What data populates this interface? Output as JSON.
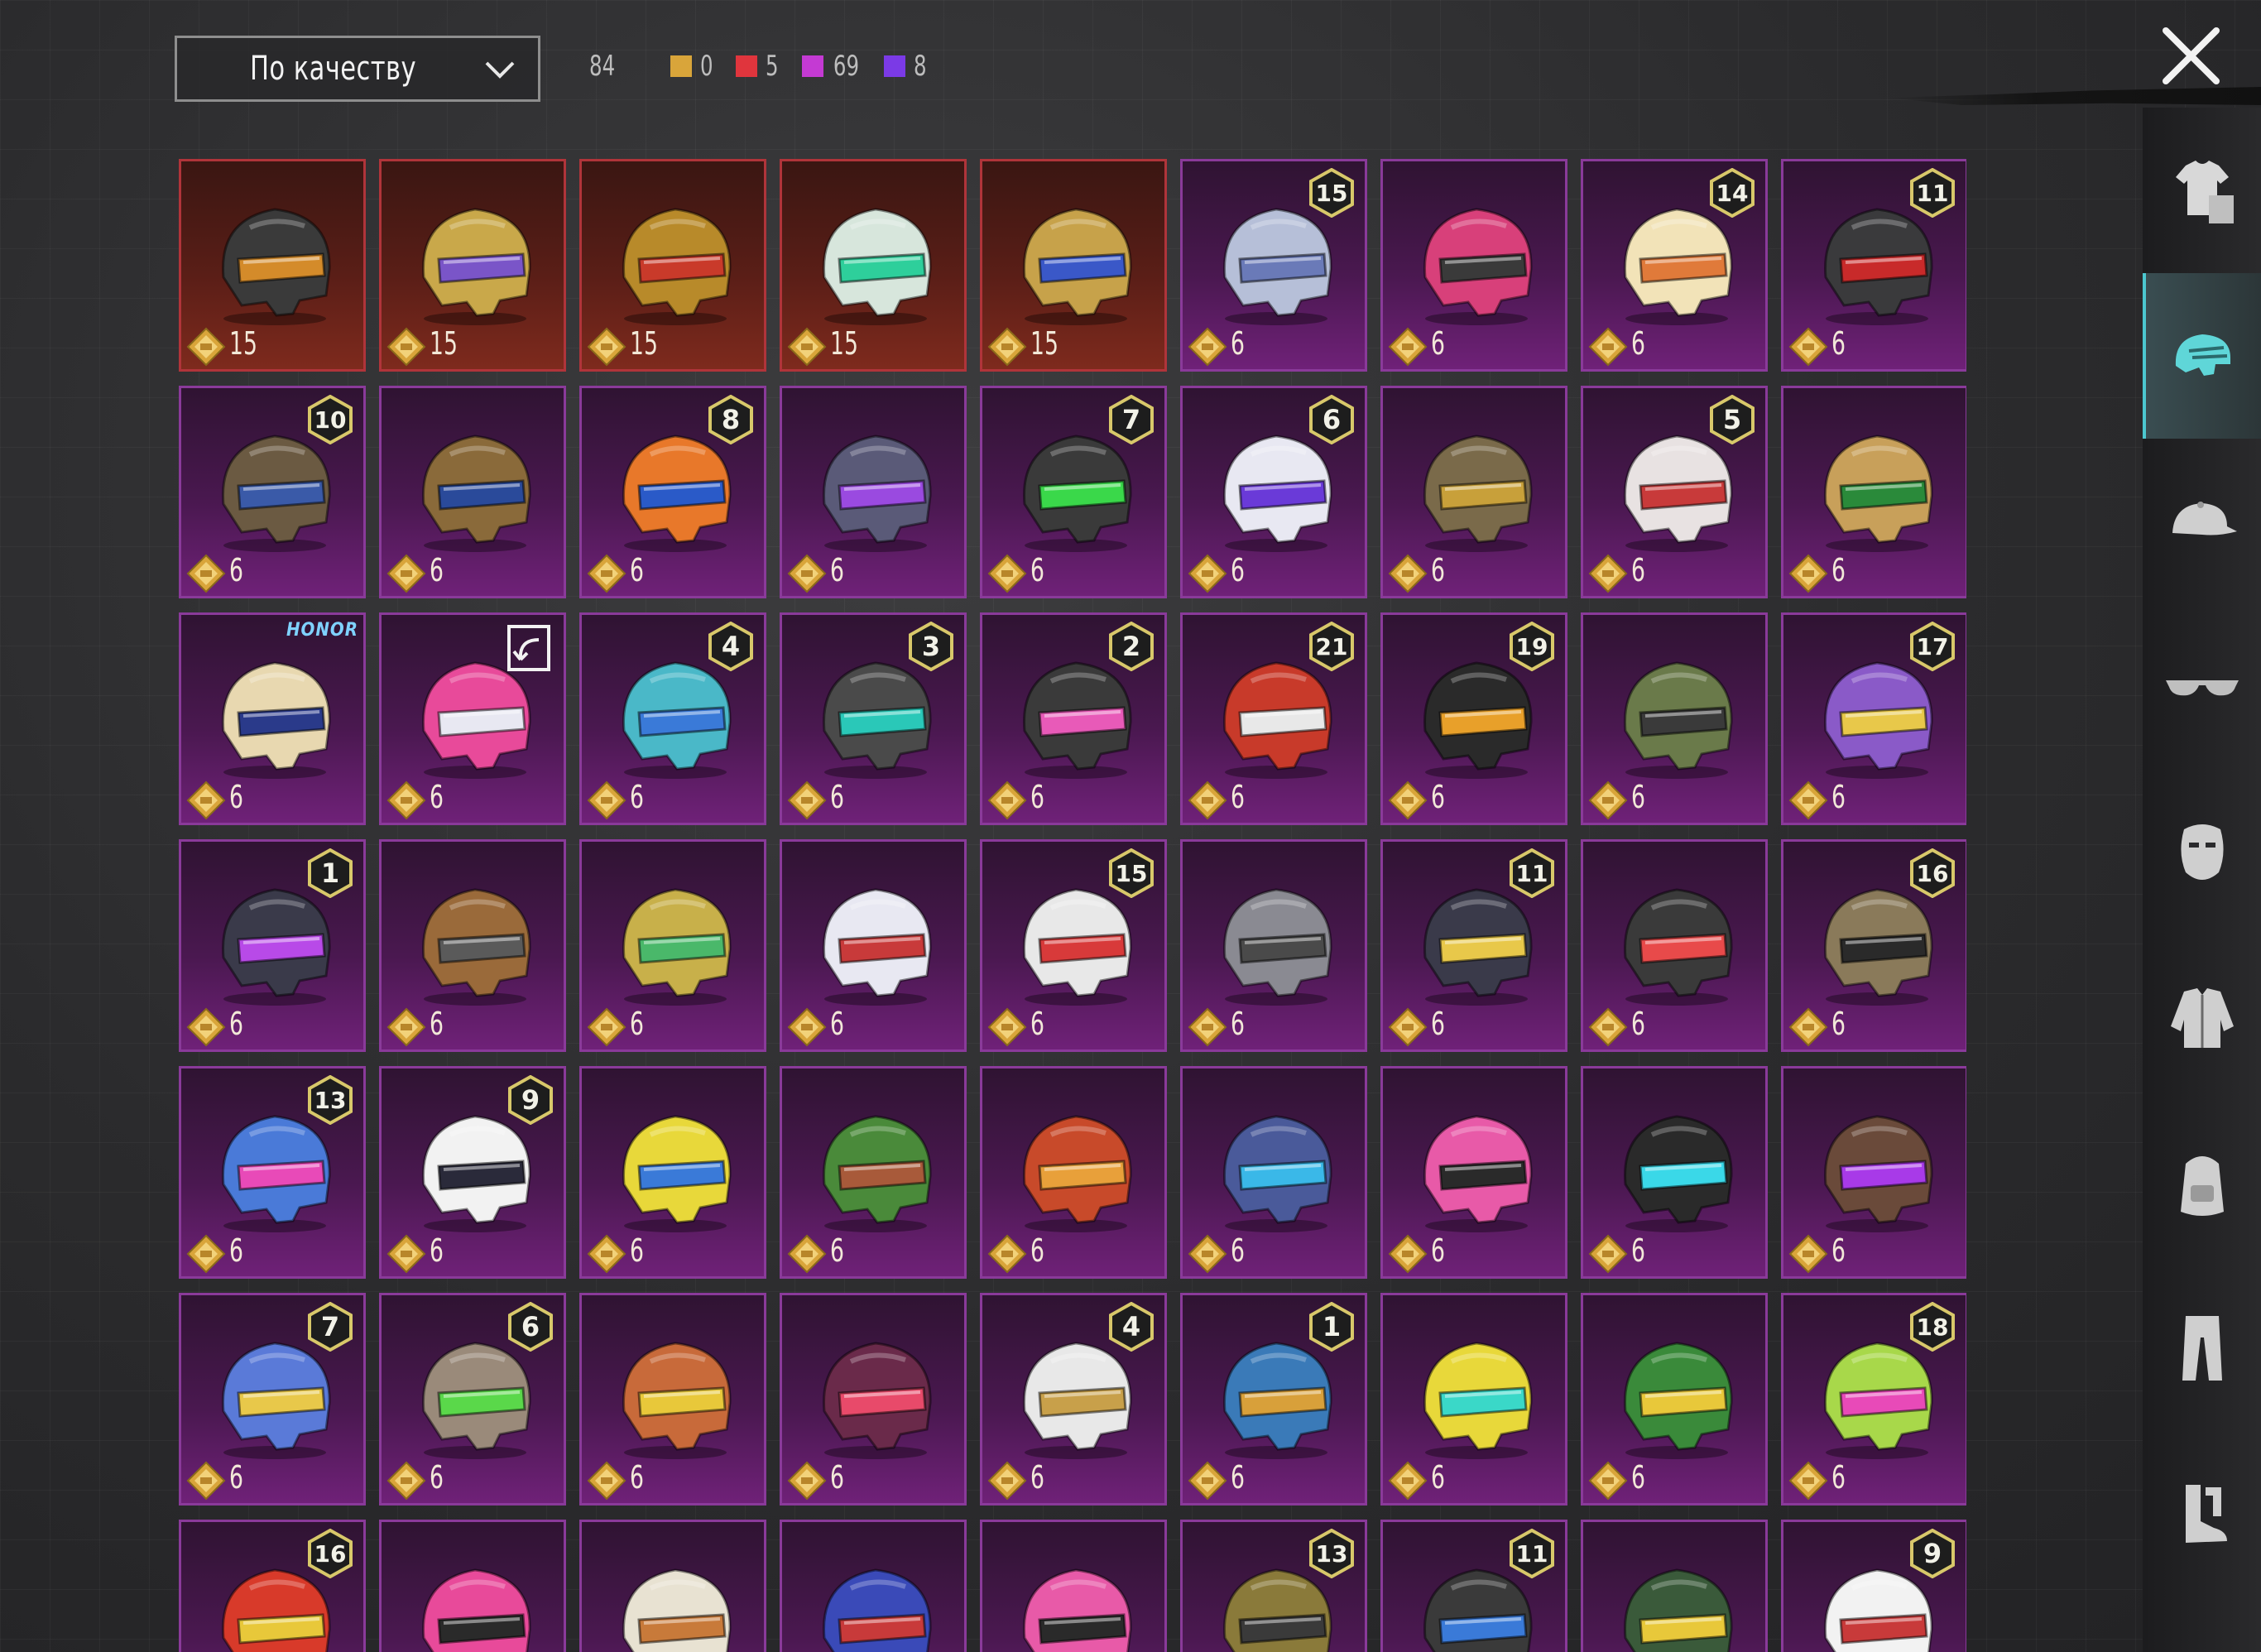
{
  "sort": {
    "label": "По качеству"
  },
  "total_count": "84",
  "rarity_counts": [
    {
      "name": "gold",
      "value": "0",
      "color": "#d9a53a"
    },
    {
      "name": "red",
      "value": "5",
      "color": "#e0353d"
    },
    {
      "name": "pink",
      "value": "69",
      "color": "#c43ad3"
    },
    {
      "name": "purple",
      "value": "8",
      "color": "#7b3ae6"
    }
  ],
  "sidebar_categories": [
    "outfit",
    "helmet",
    "hat",
    "glasses",
    "mask",
    "jacket",
    "backpack",
    "pants",
    "shoes"
  ],
  "active_category": "helmet",
  "items": [
    {
      "tier": "red",
      "value": "15",
      "badge": "",
      "color": "#3a3a3a",
      "accent": "#d48b2a"
    },
    {
      "tier": "red",
      "value": "15",
      "badge": "",
      "color": "#c9a84a",
      "accent": "#7a55c8"
    },
    {
      "tier": "red",
      "value": "15",
      "badge": "",
      "color": "#b88a2a",
      "accent": "#c93a2a"
    },
    {
      "tier": "red",
      "value": "15",
      "badge": "",
      "color": "#d7e6dc",
      "accent": "#2ecf9b"
    },
    {
      "tier": "red",
      "value": "15",
      "badge": "",
      "color": "#c7a24a",
      "accent": "#3a58c8"
    },
    {
      "tier": "pink",
      "value": "6",
      "badge": "15",
      "color": "#b6bfd8",
      "accent": "#6a7ab8"
    },
    {
      "tier": "pink",
      "value": "6",
      "badge": "",
      "color": "#d8407a",
      "accent": "#3a3a3a"
    },
    {
      "tier": "pink",
      "value": "6",
      "badge": "14",
      "color": "#f2e3b8",
      "accent": "#e07a3a"
    },
    {
      "tier": "pink",
      "value": "6",
      "badge": "11",
      "color": "#3a3a3c",
      "accent": "#c82a2a"
    },
    {
      "tier": "pink",
      "value": "6",
      "badge": "10",
      "color": "#6b5a42",
      "accent": "#3a5aa8"
    },
    {
      "tier": "pink",
      "value": "6",
      "badge": "",
      "color": "#8a6a3a",
      "accent": "#2a4a9a"
    },
    {
      "tier": "pink",
      "value": "6",
      "badge": "8",
      "color": "#e8782a",
      "accent": "#2a5ac8"
    },
    {
      "tier": "pink",
      "value": "6",
      "badge": "",
      "color": "#5a5a78",
      "accent": "#9a4ae0"
    },
    {
      "tier": "pink",
      "value": "6",
      "badge": "7",
      "color": "#3a3a3a",
      "accent": "#3ad84a"
    },
    {
      "tier": "pink",
      "value": "6",
      "badge": "6",
      "color": "#e8e8f2",
      "accent": "#6a3ad8"
    },
    {
      "tier": "pink",
      "value": "6",
      "badge": "",
      "color": "#7a6a4a",
      "accent": "#c8a03a"
    },
    {
      "tier": "pink",
      "value": "6",
      "badge": "5",
      "color": "#e8e2e2",
      "accent": "#c83a3a"
    },
    {
      "tier": "pink",
      "value": "6",
      "badge": "",
      "color": "#c8a05a",
      "accent": "#2a8a3a"
    },
    {
      "tier": "pink",
      "value": "6",
      "badge": "HONOR",
      "color": "#e8d8b0",
      "accent": "#2a3a8a"
    },
    {
      "tier": "pink",
      "value": "6",
      "badge": "share",
      "color": "#e84a9a",
      "accent": "#e8e8f2"
    },
    {
      "tier": "pink",
      "value": "6",
      "badge": "4",
      "color": "#4ab8c8",
      "accent": "#3a7ad8"
    },
    {
      "tier": "pink",
      "value": "6",
      "badge": "3",
      "color": "#4a4a4a",
      "accent": "#2ac8b8"
    },
    {
      "tier": "pink",
      "value": "6",
      "badge": "2",
      "color": "#3a3a3a",
      "accent": "#e85ab8"
    },
    {
      "tier": "pink",
      "value": "6",
      "badge": "21",
      "color": "#c83a2a",
      "accent": "#e8e8e8"
    },
    {
      "tier": "pink",
      "value": "6",
      "badge": "19",
      "color": "#2a2a2a",
      "accent": "#e8a02a"
    },
    {
      "tier": "pink",
      "value": "6",
      "badge": "",
      "color": "#6a7a4a",
      "accent": "#3a3a3a"
    },
    {
      "tier": "pink",
      "value": "6",
      "badge": "17",
      "color": "#8a5ac8",
      "accent": "#e8c84a"
    },
    {
      "tier": "pink",
      "value": "6",
      "badge": "1",
      "color": "#3a3a4a",
      "accent": "#b84ae8"
    },
    {
      "tier": "pink",
      "value": "6",
      "badge": "",
      "color": "#9a6a3a",
      "accent": "#5a5a5a"
    },
    {
      "tier": "pink",
      "value": "6",
      "badge": "",
      "color": "#c8b04a",
      "accent": "#4ab86a"
    },
    {
      "tier": "pink",
      "value": "6",
      "badge": "",
      "color": "#e8e8f2",
      "accent": "#c83a3a"
    },
    {
      "tier": "pink",
      "value": "6",
      "badge": "15",
      "color": "#e8e8e8",
      "accent": "#d83a3a"
    },
    {
      "tier": "pink",
      "value": "6",
      "badge": "",
      "color": "#8a8a92",
      "accent": "#4a4a4a"
    },
    {
      "tier": "pink",
      "value": "6",
      "badge": "11",
      "color": "#3a3a4a",
      "accent": "#e8c84a"
    },
    {
      "tier": "pink",
      "value": "6",
      "badge": "",
      "color": "#3a3a3a",
      "accent": "#e84a4a"
    },
    {
      "tier": "pink",
      "value": "6",
      "badge": "16",
      "color": "#8a7a5a",
      "accent": "#2a2a2a"
    },
    {
      "tier": "pink",
      "value": "6",
      "badge": "13",
      "color": "#4a7ad8",
      "accent": "#e84ab8"
    },
    {
      "tier": "pink",
      "value": "6",
      "badge": "9",
      "color": "#f2f2f2",
      "accent": "#2a2a3a"
    },
    {
      "tier": "pink",
      "value": "6",
      "badge": "",
      "color": "#e8d83a",
      "accent": "#3a7ad8"
    },
    {
      "tier": "pink",
      "value": "6",
      "badge": "",
      "color": "#4a8a3a",
      "accent": "#a85a3a"
    },
    {
      "tier": "pink",
      "value": "6",
      "badge": "",
      "color": "#c84a2a",
      "accent": "#e8a03a"
    },
    {
      "tier": "pink",
      "value": "6",
      "badge": "",
      "color": "#4a5a9a",
      "accent": "#3ab8e8"
    },
    {
      "tier": "pink",
      "value": "6",
      "badge": "",
      "color": "#e85aa8",
      "accent": "#2a2a2a"
    },
    {
      "tier": "pink",
      "value": "6",
      "badge": "",
      "color": "#2a2a2a",
      "accent": "#3ad8e8"
    },
    {
      "tier": "pink",
      "value": "6",
      "badge": "",
      "color": "#6a4a3a",
      "accent": "#a83ae8"
    },
    {
      "tier": "pink",
      "value": "6",
      "badge": "7",
      "color": "#5a7ad8",
      "accent": "#e8c84a"
    },
    {
      "tier": "pink",
      "value": "6",
      "badge": "6",
      "color": "#9a8a7a",
      "accent": "#5ad84a"
    },
    {
      "tier": "pink",
      "value": "6",
      "badge": "",
      "color": "#c86a3a",
      "accent": "#e8c83a"
    },
    {
      "tier": "pink",
      "value": "6",
      "badge": "",
      "color": "#6a2a4a",
      "accent": "#e84a6a"
    },
    {
      "tier": "pink",
      "value": "6",
      "badge": "4",
      "color": "#e8e8e8",
      "accent": "#c8a04a"
    },
    {
      "tier": "pink",
      "value": "6",
      "badge": "1",
      "color": "#3a7ab8",
      "accent": "#d8a03a"
    },
    {
      "tier": "pink",
      "value": "6",
      "badge": "",
      "color": "#e8d83a",
      "accent": "#3ad8c8"
    },
    {
      "tier": "pink",
      "value": "6",
      "badge": "",
      "color": "#3a8a3a",
      "accent": "#e8c83a"
    },
    {
      "tier": "pink",
      "value": "6",
      "badge": "18",
      "color": "#a8d84a",
      "accent": "#e84ab8"
    },
    {
      "tier": "pink",
      "value": "",
      "badge": "16",
      "color": "#d83a2a",
      "accent": "#e8c83a"
    },
    {
      "tier": "pink",
      "value": "",
      "badge": "",
      "color": "#e84a9a",
      "accent": "#2a2a2a"
    },
    {
      "tier": "pink",
      "value": "",
      "badge": "",
      "color": "#e8e2d2",
      "accent": "#c87a3a"
    },
    {
      "tier": "pink",
      "value": "",
      "badge": "",
      "color": "#3a4ab8",
      "accent": "#c83a3a"
    },
    {
      "tier": "pink",
      "value": "",
      "badge": "",
      "color": "#e85aa8",
      "accent": "#2a2a2a"
    },
    {
      "tier": "pink",
      "value": "",
      "badge": "13",
      "color": "#8a7a3a",
      "accent": "#3a3a3a"
    },
    {
      "tier": "pink",
      "value": "",
      "badge": "11",
      "color": "#3a3a3a",
      "accent": "#3a7ad8"
    },
    {
      "tier": "pink",
      "value": "",
      "badge": "",
      "color": "#3a5a3a",
      "accent": "#e8c83a"
    },
    {
      "tier": "pink",
      "value": "",
      "badge": "9",
      "color": "#f2f2f2",
      "accent": "#c83a3a"
    }
  ]
}
